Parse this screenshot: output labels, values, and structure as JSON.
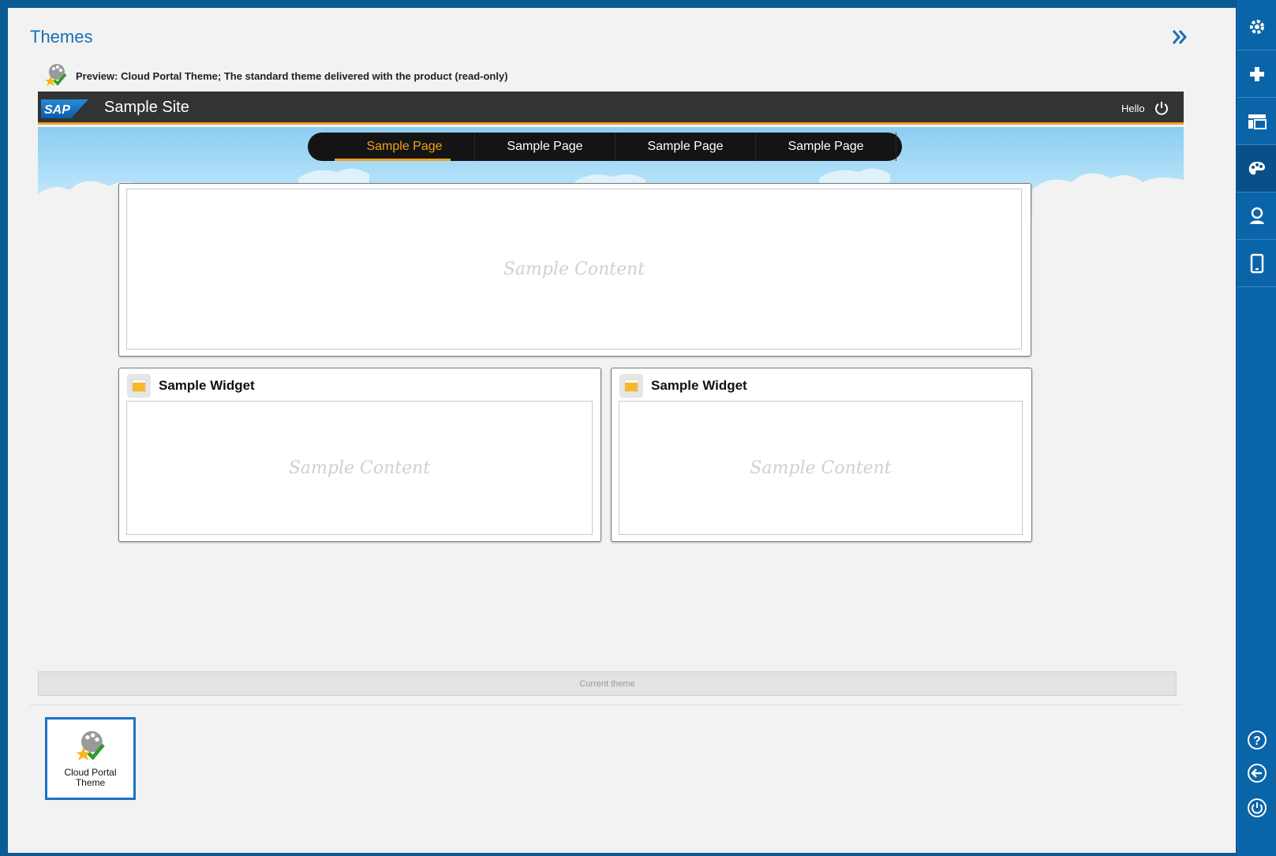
{
  "themes_panel": {
    "title": "Themes",
    "collapse_icon": "double-chevron-right-icon",
    "preview_text": "Preview: Cloud Portal Theme; The standard theme delivered with the product (read-only)"
  },
  "site_preview": {
    "logo_text": "SAP",
    "site_title": "Sample Site",
    "greeting": "Hello",
    "nav": [
      {
        "label": "Sample Page",
        "active": true
      },
      {
        "label": "Sample Page",
        "active": false
      },
      {
        "label": "Sample Page",
        "active": false
      },
      {
        "label": "Sample Page",
        "active": false
      }
    ],
    "main_content": "Sample Content",
    "widgets": [
      {
        "title": "Sample Widget",
        "content": "Sample Content"
      },
      {
        "title": "Sample Widget",
        "content": "Sample Content"
      }
    ]
  },
  "current_theme_label": "Current theme",
  "theme_tile": {
    "label": "Cloud Portal Theme"
  },
  "right_sidebar": {
    "items": [
      "gear-icon",
      "plus-icon",
      "page-layout-icon",
      "palette-icon",
      "user-icon",
      "mobile-icon"
    ],
    "bottom": [
      "help-icon",
      "back-icon",
      "power-icon"
    ]
  },
  "colors": {
    "accent": "#1a6fb6",
    "highlight": "#f0a01e",
    "header_bg": "#333333"
  }
}
